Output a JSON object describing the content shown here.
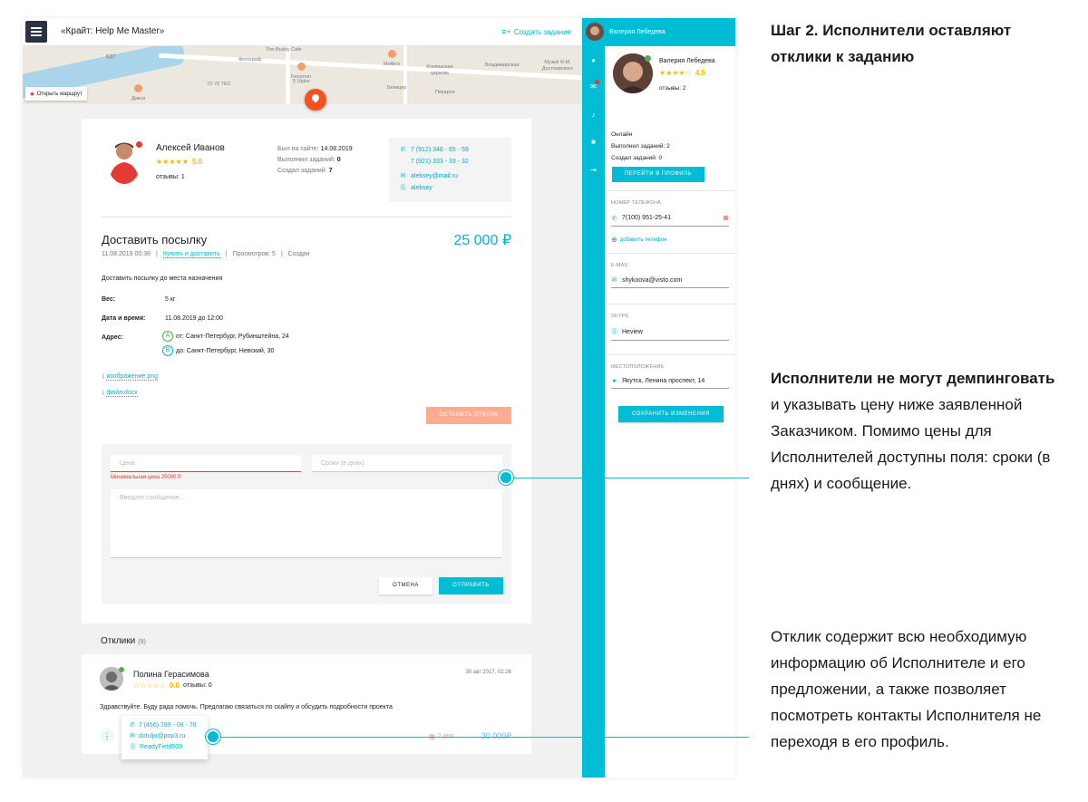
{
  "app": {
    "title": "«Крайт: Help Me Master»",
    "create_task": "Создать задание"
  },
  "map": {
    "route_button": "Открыть маршрут",
    "labels": [
      "The Buddy Cafe",
      "БДТ",
      "Фотограф",
      "Feromon",
      "5 Uglov",
      "Mollie's",
      "Конюшская церковь",
      "Владимирская",
      "Музей Ф.М. Достоевского",
      "72-76 TEC",
      "Дикси",
      "Бекицер",
      "Пекарня"
    ]
  },
  "author": {
    "name": "Алексей Иванов",
    "stars": "★★★★★",
    "rating": "5.0",
    "reviews": "отзывы: 1",
    "last_seen_label": "Был на сайте:",
    "last_seen": "14.08.2019",
    "completed_label": "Выполнил заданий:",
    "completed": "0",
    "created_label": "Создал заданий:",
    "created": "7",
    "phone1": "7 (912) 346 - 65 - 59",
    "phone2": "7 (921) 333 - 33 - 32",
    "email": "aleksey@mail.ru",
    "skype": "aleksey"
  },
  "task": {
    "title": "Доставить посылку",
    "price": "25 000 ₽",
    "date": "11.08.2019 00:38",
    "category": "Купить и доставить",
    "views": "Просмотров: 5",
    "status": "Создан",
    "description": "Доставить посылку до места назначения",
    "weight_label": "Вес:",
    "weight": "5 кг",
    "datetime_label": "Дата и время:",
    "datetime": "11.08.2019 до 12:00",
    "address_label": "Адрес:",
    "from_mark": "A",
    "from": "от: Санкт-Петербург, Рубинштейна, 24",
    "to_mark": "B",
    "to": "до: Санкт-Петербург, Невский, 30",
    "file1": "изображение.png",
    "file2": "файл.docx",
    "leave_response": "ОСТАВИТЬ ОТКЛИК"
  },
  "form": {
    "price_placeholder": "Цена",
    "days_placeholder": "Сроки (в днях)",
    "error": "Минимальная цена 25000 Р.",
    "message_placeholder": "Введите сообщение...",
    "cancel": "ОТМЕНА",
    "submit": "ОТПРАВИТЬ"
  },
  "responses": {
    "title": "Отклики",
    "count": "(9)",
    "item": {
      "name": "Полина Герасимова",
      "date": "30 авг 2017, 02:26",
      "stars": "☆☆☆☆☆",
      "rating": "0.0",
      "reviews": "отзывы: 0",
      "text": "Здравствуйте. Буду рада помочь. Предлагаю связаться по скайпу и обсудить подробности проекта",
      "phone": "7 (456) 789 - 08 - 76",
      "email": "dotuljo@pop3.ru",
      "skype": "ReadyField509",
      "days": "2 дня",
      "price": "30 000₽"
    }
  },
  "panel": {
    "user_header": "Валерия Лебедева",
    "name": "Валерия Лебедева",
    "stars": "★★★★☆",
    "rating": "4.5",
    "reviews": "отзывы: 2",
    "status": "Онлайн",
    "completed": "Выполнил заданий: 2",
    "created": "Создал заданий: 0",
    "profile_button": "ПЕРЕЙТИ В ПРОФИЛЬ",
    "phone_label": "НОМЕР ТЕЛЕФОНА",
    "phone": "7(100) 951-25-41",
    "add_phone": "добавить телефон",
    "email_label": "E-MAIL",
    "email": "shykoova@visto.com",
    "skype_label": "SKYPE",
    "skype": "Heview",
    "location_label": "МЕСТОПОЛОЖЕНИЕ",
    "location": "Якутск, Ленина проспект, 14",
    "save_button": "СОХРАНИТЬ ИЗМЕНЕНИЯ"
  },
  "notes": {
    "step_title": "Шаг 2. Исполнители оставляют отклики к заданию",
    "note1_bold": "Исполнители не могут демпинговать",
    "note1_rest": " и указывать цену ниже заявленной Заказчиком. Помимо цены для Исполнителей доступны поля: сроки (в днях) и сообщение.",
    "note2": "Отклик содержит всю необходимую информацию об Исполнителе и его предложении, а также позволяет посмотреть контакты Исполнителя не переходя в его профиль."
  },
  "colors": {
    "accent": "#00bcd4",
    "star": "#ffb400",
    "pin": "#f4511e",
    "error": "#e53935"
  }
}
